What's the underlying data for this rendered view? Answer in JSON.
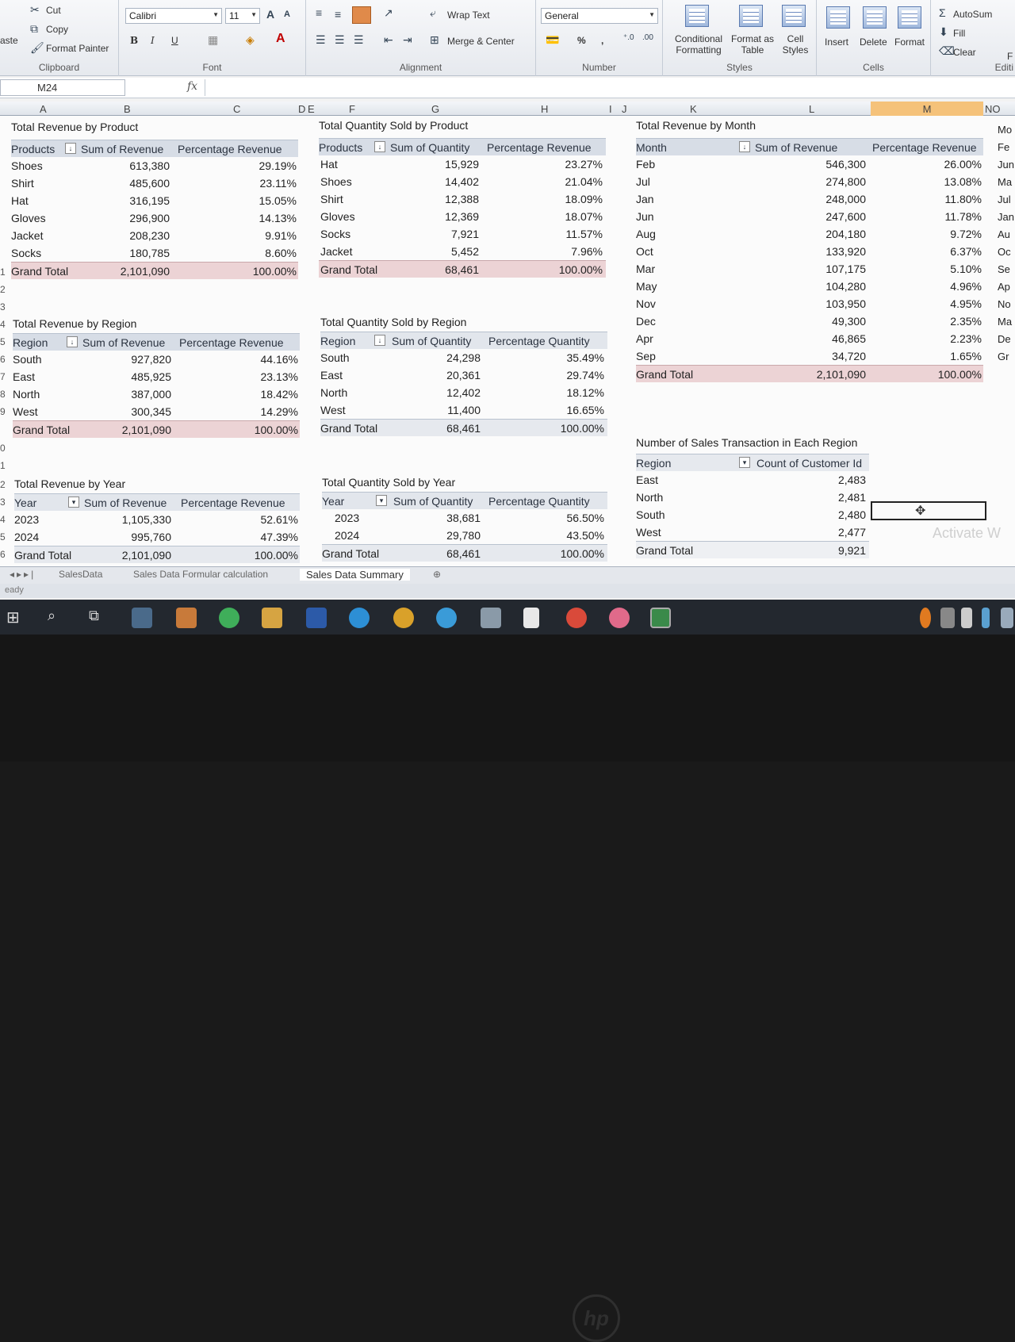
{
  "ribbon": {
    "clipboard": {
      "cut": "Cut",
      "copy": "Copy",
      "format_painter": "Format Painter",
      "paste": "aste",
      "group": "Clipboard"
    },
    "font": {
      "name": "Calibri",
      "size": "11",
      "bold": "B",
      "italic": "I",
      "underline": "U",
      "group": "Font"
    },
    "alignment": {
      "wrap": "Wrap Text",
      "merge": "Merge & Center",
      "group": "Alignment"
    },
    "number": {
      "format": "General",
      "percent": "%",
      "comma": ",",
      "group": "Number"
    },
    "styles": {
      "conditional": "Conditional Formatting",
      "format_table": "Format as Table",
      "cell_styles": "Cell Styles",
      "group": "Styles"
    },
    "cells": {
      "insert": "Insert",
      "delete": "Delete",
      "format": "Format",
      "group": "Cells"
    },
    "editing": {
      "autosum": "AutoSum",
      "fill": "Fill",
      "clear": "Clear",
      "group": "Editi",
      "extra_f": "F"
    }
  },
  "formula_bar": {
    "name_box": "M24",
    "fx": "fx",
    "value": ""
  },
  "columns": [
    "A",
    "B",
    "C",
    "D",
    "E",
    "F",
    "G",
    "H",
    "I",
    "J",
    "K",
    "L",
    "M",
    "NO"
  ],
  "rows": [
    "1",
    "2",
    "3",
    "4",
    "5",
    "6",
    "7",
    "8",
    "9",
    "0",
    "1",
    "2",
    "3",
    "4",
    "5",
    "6"
  ],
  "tables": {
    "rev_product": {
      "title": "Total Revenue by Product",
      "headers": [
        "Products",
        "Sum of Revenue",
        "Percentage Revenue"
      ],
      "rows": [
        [
          "Shoes",
          "613,380",
          "29.19%"
        ],
        [
          "Shirt",
          "485,600",
          "23.11%"
        ],
        [
          "Hat",
          "316,195",
          "15.05%"
        ],
        [
          "Gloves",
          "296,900",
          "14.13%"
        ],
        [
          "Jacket",
          "208,230",
          "9.91%"
        ],
        [
          "Socks",
          "180,785",
          "8.60%"
        ]
      ],
      "total": [
        "Grand Total",
        "2,101,090",
        "100.00%"
      ]
    },
    "qty_product": {
      "title": "Total Quantity Sold by Product",
      "headers": [
        "Products",
        "Sum of Quantity",
        "Percentage Revenue"
      ],
      "rows": [
        [
          "Hat",
          "15,929",
          "23.27%"
        ],
        [
          "Shoes",
          "14,402",
          "21.04%"
        ],
        [
          "Shirt",
          "12,388",
          "18.09%"
        ],
        [
          "Gloves",
          "12,369",
          "18.07%"
        ],
        [
          "Socks",
          "7,921",
          "11.57%"
        ],
        [
          "Jacket",
          "5,452",
          "7.96%"
        ]
      ],
      "total": [
        "Grand Total",
        "68,461",
        "100.00%"
      ]
    },
    "rev_month": {
      "title": "Total Revenue by Month",
      "headers": [
        "Month",
        "Sum of Revenue",
        "Percentage Revenue"
      ],
      "rows": [
        [
          "Feb",
          "546,300",
          "26.00%"
        ],
        [
          "Jul",
          "274,800",
          "13.08%"
        ],
        [
          "Jan",
          "248,000",
          "11.80%"
        ],
        [
          "Jun",
          "247,600",
          "11.78%"
        ],
        [
          "Aug",
          "204,180",
          "9.72%"
        ],
        [
          "Oct",
          "133,920",
          "6.37%"
        ],
        [
          "Mar",
          "107,175",
          "5.10%"
        ],
        [
          "May",
          "104,280",
          "4.96%"
        ],
        [
          "Nov",
          "103,950",
          "4.95%"
        ],
        [
          "Dec",
          "49,300",
          "2.35%"
        ],
        [
          "Apr",
          "46,865",
          "2.23%"
        ],
        [
          "Sep",
          "34,720",
          "1.65%"
        ]
      ],
      "total": [
        "Grand Total",
        "2,101,090",
        "100.00%"
      ]
    },
    "rev_region": {
      "title": "Total Revenue by Region",
      "headers": [
        "Region",
        "Sum of Revenue",
        "Percentage Revenue"
      ],
      "rows": [
        [
          "South",
          "927,820",
          "44.16%"
        ],
        [
          "East",
          "485,925",
          "23.13%"
        ],
        [
          "North",
          "387,000",
          "18.42%"
        ],
        [
          "West",
          "300,345",
          "14.29%"
        ]
      ],
      "total": [
        "Grand Total",
        "2,101,090",
        "100.00%"
      ]
    },
    "qty_region": {
      "title": "Total Quantity Sold by Region",
      "headers": [
        "Region",
        "Sum of Quantity",
        "Percentage Quantity"
      ],
      "rows": [
        [
          "South",
          "24,298",
          "35.49%"
        ],
        [
          "East",
          "20,361",
          "29.74%"
        ],
        [
          "North",
          "12,402",
          "18.12%"
        ],
        [
          "West",
          "11,400",
          "16.65%"
        ]
      ],
      "total": [
        "Grand Total",
        "68,461",
        "100.00%"
      ]
    },
    "rev_year": {
      "title": "Total Revenue by Year",
      "headers": [
        "Year",
        "Sum of Revenue",
        "Percentage Revenue"
      ],
      "rows": [
        [
          "2023",
          "1,105,330",
          "52.61%"
        ],
        [
          "2024",
          "995,760",
          "47.39%"
        ]
      ],
      "total": [
        "Grand Total",
        "2,101,090",
        "100.00%"
      ]
    },
    "qty_year": {
      "title": "Total Quantity Sold by Year",
      "headers": [
        "Year",
        "Sum of Quantity",
        "Percentage Quantity"
      ],
      "rows": [
        [
          "2023",
          "38,681",
          "56.50%"
        ],
        [
          "2024",
          "29,780",
          "43.50%"
        ]
      ],
      "total": [
        "Grand Total",
        "68,461",
        "100.00%"
      ]
    },
    "tx_region": {
      "title": "Number of Sales Transaction in Each Region",
      "headers": [
        "Region",
        "Count of Customer Id"
      ],
      "rows": [
        [
          "East",
          "2,483"
        ],
        [
          "North",
          "2,481"
        ],
        [
          "South",
          "2,480"
        ],
        [
          "West",
          "2,477"
        ]
      ],
      "total": [
        "Grand Total",
        "9,921"
      ]
    },
    "partial_m": {
      "items": [
        "Mo",
        "Fe",
        "Jun",
        "Ma",
        "Jul",
        "Jan",
        "Au",
        "Oc",
        "Se",
        "Ap",
        "No",
        "Ma",
        "De",
        "Gr"
      ]
    }
  },
  "sheet_tabs": [
    "SalesData",
    "Sales Data Formular calculation",
    "Sales Data Summary"
  ],
  "status": "eady",
  "watermark": "Activate W"
}
